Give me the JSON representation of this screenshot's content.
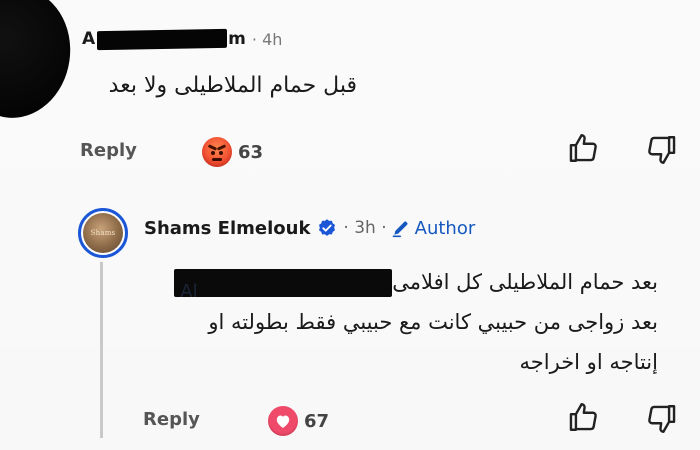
{
  "comments": [
    {
      "author_first": "A",
      "author_last": "m",
      "time": "· 4h",
      "text": "قبل حمام الملاطيلى ولا بعد",
      "reply_label": "Reply",
      "reaction": {
        "type": "angry",
        "count": "63"
      },
      "like_icon": "thumbs-up-icon",
      "dislike_icon": "thumbs-down-icon"
    }
  ],
  "reply": {
    "author": "Shams Elmelouk",
    "verified_icon": "verified-check-icon",
    "time": "· 3h ·",
    "author_badge": "Author",
    "author_badge_icon": "pencil-icon",
    "avatar_text": "Shams",
    "mention_ghost": "Al",
    "line1": "بعد حمام الملاطيلى كل افلامى",
    "line2": "بعد زواجى من حبيبي  كانت مع حبيبي فقط بطولته او",
    "line3": "إنتاجه او اخراجه",
    "reply_label": "Reply",
    "reaction": {
      "type": "love",
      "count": "67"
    },
    "like_icon": "thumbs-up-icon",
    "dislike_icon": "thumbs-down-icon"
  },
  "colors": {
    "accent_blue": "#1a56d6",
    "author_blue": "#1558c0",
    "angry": "#f04a2f",
    "love": "#f04a6a"
  }
}
